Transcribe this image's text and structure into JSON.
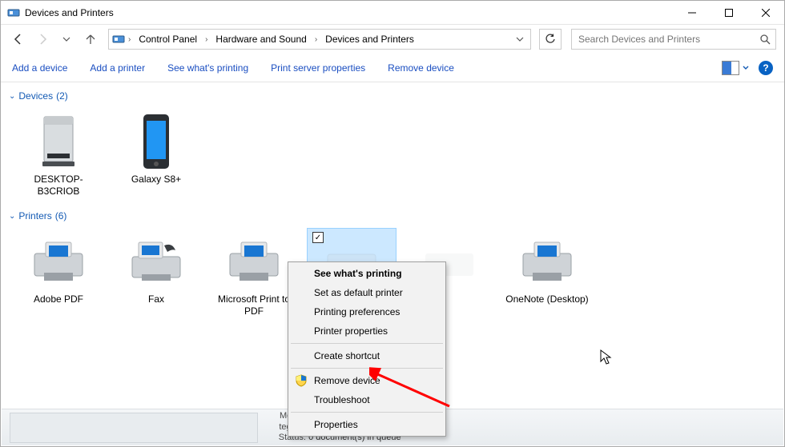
{
  "window": {
    "title": "Devices and Printers"
  },
  "breadcrumb": {
    "items": [
      "Control Panel",
      "Hardware and Sound",
      "Devices and Printers"
    ]
  },
  "search": {
    "placeholder": "Search Devices and Printers"
  },
  "toolbar": {
    "add_device": "Add a device",
    "add_printer": "Add a printer",
    "see_printing": "See what's printing",
    "print_server": "Print server properties",
    "remove_device": "Remove device"
  },
  "groups": {
    "devices": {
      "label": "Devices",
      "count": "(2)"
    },
    "printers": {
      "label": "Printers",
      "count": "(6)"
    }
  },
  "devices": [
    {
      "label": "DESKTOP-B3CRIOB"
    },
    {
      "label": "Galaxy S8+"
    }
  ],
  "printers": [
    {
      "label": "Adobe PDF"
    },
    {
      "label": "Fax"
    },
    {
      "label": "Microsoft Print to PDF"
    },
    {
      "label": ""
    },
    {
      "label": ""
    },
    {
      "label": "OneNote (Desktop)"
    }
  ],
  "context_menu": {
    "see_printing": "See what's printing",
    "set_default": "Set as default printer",
    "preferences": "Printing preferences",
    "properties_printer": "Printer properties",
    "create_shortcut": "Create shortcut",
    "remove_device": "Remove device",
    "troubleshoot": "Troubleshoot",
    "properties": "Properties"
  },
  "details": {
    "model_k": "Model:",
    "category_k": "tegory:",
    "status_k": "Status:",
    "status_v": "0 document(s) in queue"
  }
}
